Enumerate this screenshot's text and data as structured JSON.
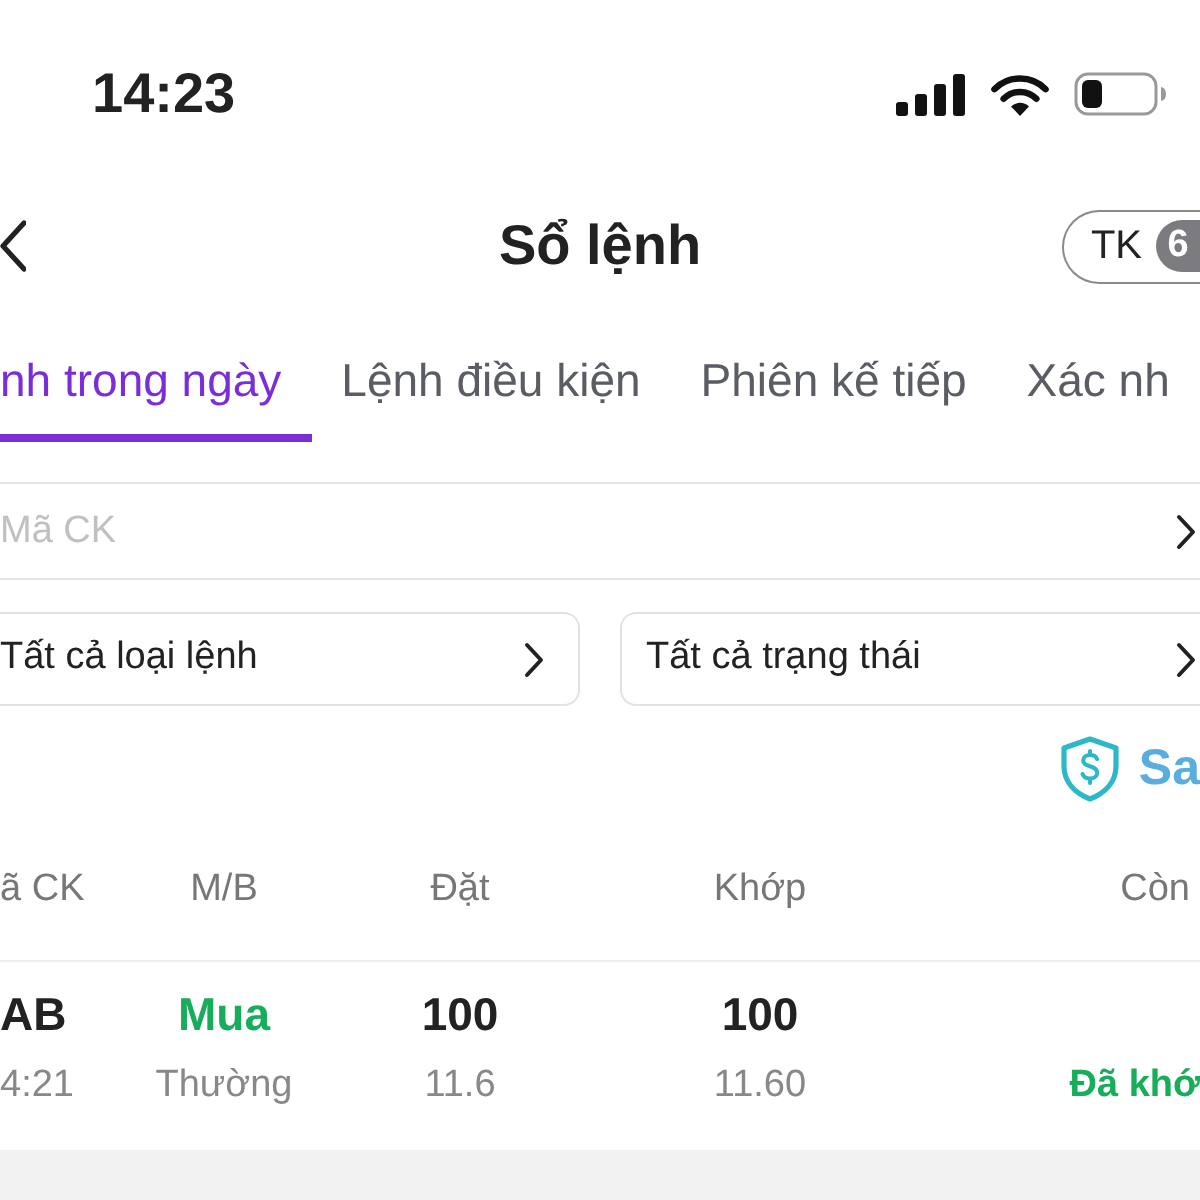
{
  "status_bar": {
    "time": "14:23"
  },
  "header": {
    "title": "Sổ lệnh",
    "account_badge": {
      "label": "TK",
      "count": "6"
    }
  },
  "tabs": [
    {
      "label": "nh trong ngày",
      "selected": true
    },
    {
      "label": "Lệnh điều kiện",
      "selected": false
    },
    {
      "label": "Phiên kế tiếp",
      "selected": false
    },
    {
      "label": "Xác nh",
      "selected": false
    }
  ],
  "search": {
    "placeholder": "Mã CK"
  },
  "filters": [
    {
      "label": "Tất cả loại lệnh"
    },
    {
      "label": "Tất cả trạng thái"
    }
  ],
  "link": {
    "label": "Sa"
  },
  "table": {
    "columns": [
      "ã CK",
      "M/B",
      "Đặt",
      "Khớp",
      "Còn"
    ],
    "rows": [
      {
        "symbol": "AB",
        "time": "4:21",
        "side": {
          "label": "Mua",
          "kind": "buy"
        },
        "order_type": "Thường",
        "order_qty": "100",
        "order_price": "11.6",
        "matched_qty": "100",
        "matched_price": "11.60",
        "status": {
          "label": "Đã khớ",
          "kind": "filled"
        }
      }
    ]
  }
}
